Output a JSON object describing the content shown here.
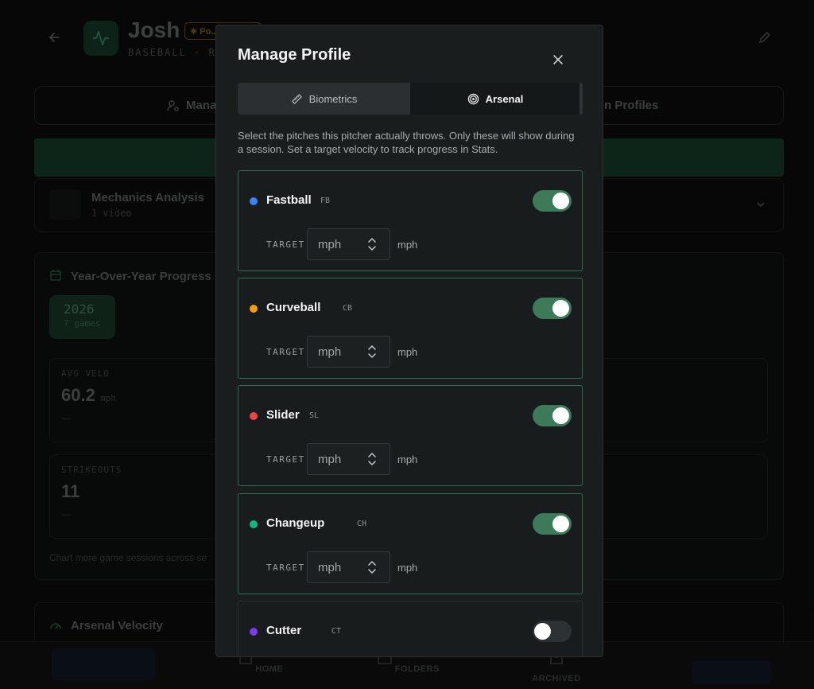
{
  "background": {
    "athlete_name": "Josh",
    "badge": "Po...",
    "athlete_meta": "BASEBALL · RHP",
    "tab_manage": "Mana",
    "tab_profiles": "n Profiles",
    "mechanics": {
      "title": "Mechanics Analysis",
      "subtitle": "1 video"
    },
    "yoy": {
      "title": "Year-Over-Year Progress",
      "year": "2026",
      "games": "7 games",
      "stats": [
        {
          "label": "AVG VELO",
          "value": "60.2",
          "unit": "mph",
          "change": "—"
        },
        {
          "label": "STRIKEOUTS",
          "value": "11",
          "unit": "",
          "change": "—"
        }
      ],
      "note": "Chart more game sessions across se"
    },
    "arsenal_title": "Arsenal Velocity",
    "nav": {
      "home": "HOME",
      "folders": "FOLDERS",
      "archived": "ARCHIVED"
    }
  },
  "modal": {
    "title": "Manage Profile",
    "tabs": {
      "biometrics": "Biometrics",
      "arsenal": "Arsenal"
    },
    "active_tab": "Arsenal",
    "description": "Select the pitches this pitcher actually throws. Only these will show during a session. Set a target velocity to track progress in Stats.",
    "target_label": "TARGET",
    "unit_label": "mph",
    "input_placeholder": "mph",
    "pitches": [
      {
        "name": "Fastball",
        "abbr": "FB",
        "color": "#3b82f6",
        "enabled": true
      },
      {
        "name": "Curveball",
        "abbr": "CB",
        "color": "#f59e0b",
        "enabled": true
      },
      {
        "name": "Slider",
        "abbr": "SL",
        "color": "#ef4444",
        "enabled": true
      },
      {
        "name": "Changeup",
        "abbr": "CH",
        "color": "#10b981",
        "enabled": true
      },
      {
        "name": "Cutter",
        "abbr": "CT",
        "color": "#7c3aed",
        "enabled": false
      }
    ]
  }
}
